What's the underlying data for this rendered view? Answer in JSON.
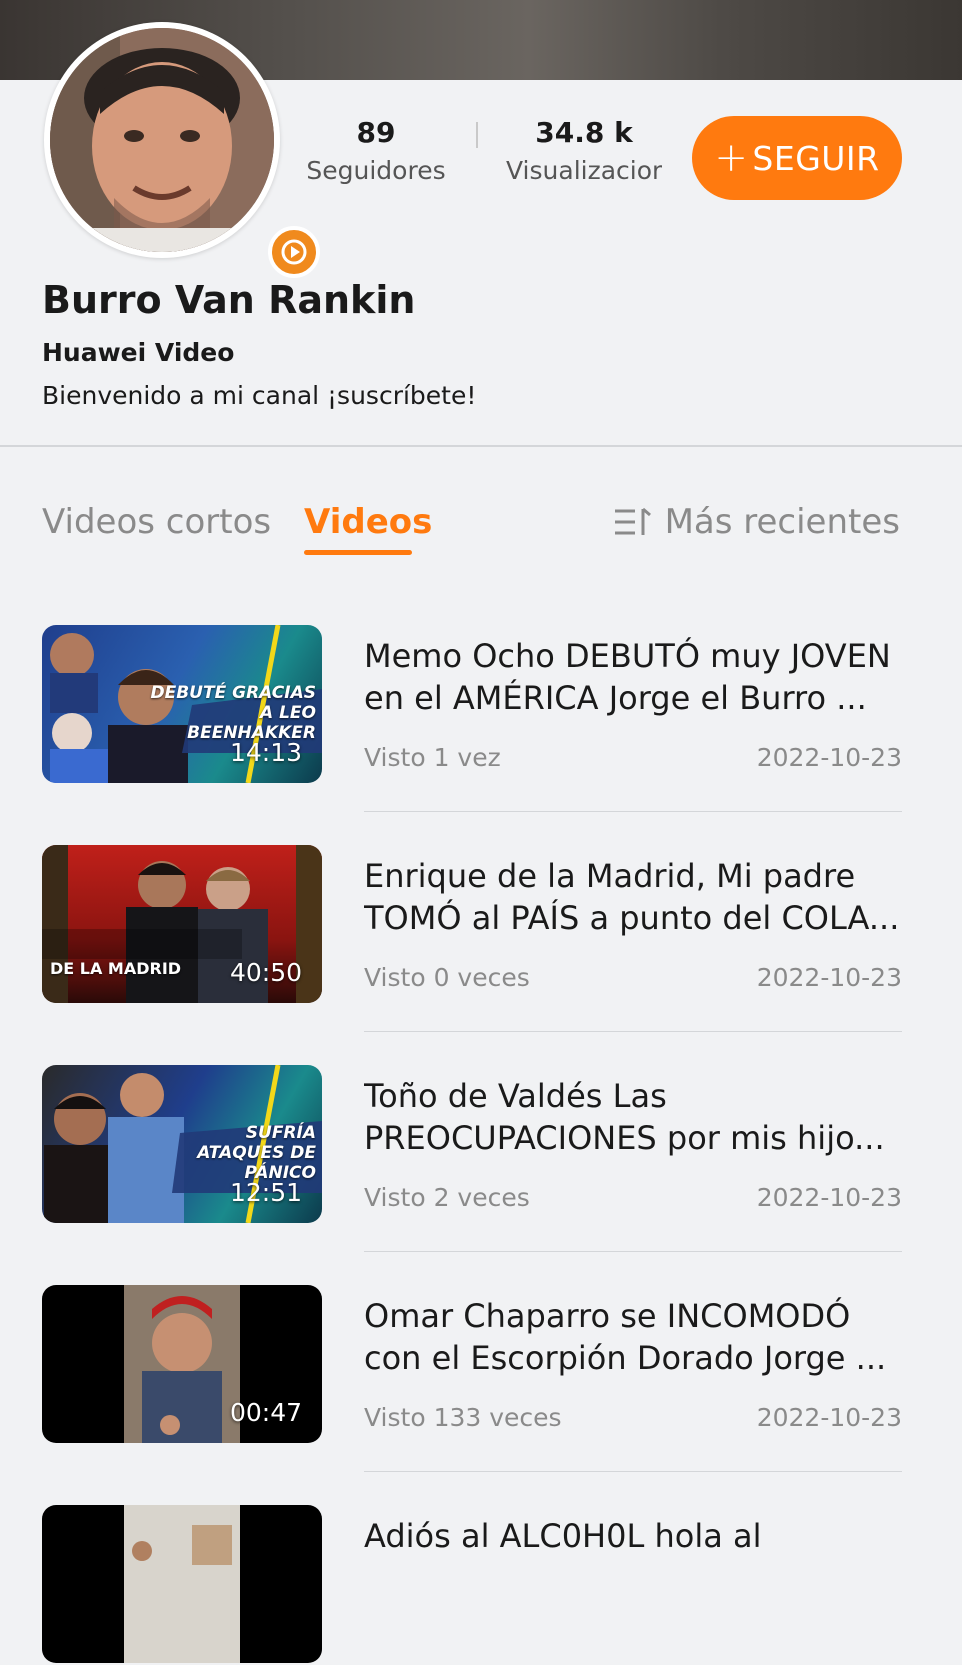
{
  "channel": {
    "name": "Burro Van Rankin",
    "subtitle": "Huawei Video",
    "description": "Bienvenido a mi canal ¡suscríbete!"
  },
  "stats": {
    "followers_value": "89",
    "followers_label": "Seguidores",
    "views_value": "34.8 k",
    "views_label": "Visualizaciones"
  },
  "follow_button": {
    "plus": "+",
    "label": "SEGUIR"
  },
  "tabs": {
    "short_videos": "Videos cortos",
    "videos": "Videos",
    "sort_label": "Más recientes"
  },
  "videos": [
    {
      "title": "Memo Ocho DEBUTÓ muy JOVEN en el AMÉRICA   Jorge el Burro ...",
      "views": "Visto 1 vez",
      "date": "2022-10-23",
      "duration": "14:13",
      "caption": "DEBUTÉ GRACIAS A LEO BEENHAKKER"
    },
    {
      "title": "Enrique de la Madrid, Mi padre TOMÓ al PAÍS a punto del COLA...",
      "views": "Visto 0 veces",
      "date": "2022-10-23",
      "duration": "40:50",
      "caption": "DE LA MADRID"
    },
    {
      "title": "Toño de Valdés Las PREOCUPACIONES por mis hijo...",
      "views": "Visto 2 veces",
      "date": "2022-10-23",
      "duration": "12:51",
      "caption": "SUFRÍA ATAQUES DE PÁNICO"
    },
    {
      "title": "Omar Chaparro se INCOMODÓ con el Escorpión Dorado  Jorge ...",
      "views": "Visto 133 veces",
      "date": "2022-10-23",
      "duration": "00:47",
      "caption": ""
    },
    {
      "title": "Adiós al ALC0H0L   hola al",
      "views": "",
      "date": "",
      "duration": "",
      "caption": ""
    }
  ],
  "icons": {
    "play_badge": "play-circle-icon",
    "sort": "sort-lines-icon"
  },
  "colors": {
    "accent": "#ff7a0f",
    "background": "#f1f2f4"
  }
}
